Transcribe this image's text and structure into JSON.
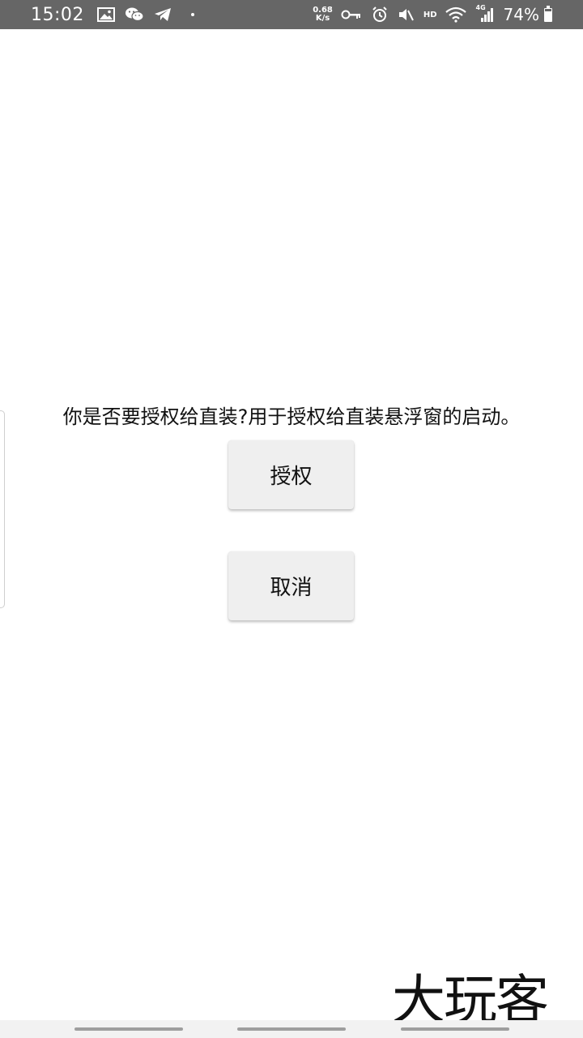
{
  "status_bar": {
    "time": "15:02",
    "net_speed_value": "0.68",
    "net_speed_unit": "K/s",
    "hd_label": "HD",
    "network_label": "4G",
    "battery_percent": "74%",
    "battery_level": 0.74,
    "icons": [
      "gallery-icon",
      "wechat-icon",
      "telegram-icon",
      "notification-dot-icon",
      "key-icon",
      "alarm-icon",
      "mute-icon",
      "wifi-icon",
      "signal-icon",
      "battery-icon"
    ]
  },
  "dialog": {
    "message": "你是否要授权给直装?用于授权给直装悬浮窗的启动。",
    "authorize_label": "授权",
    "cancel_label": "取消"
  },
  "watermark": {
    "text": "大玩客"
  },
  "colors": {
    "status_bar_bg": "#666666",
    "button_bg": "#efefef",
    "nav_bar_bg": "#f2f2f2"
  }
}
